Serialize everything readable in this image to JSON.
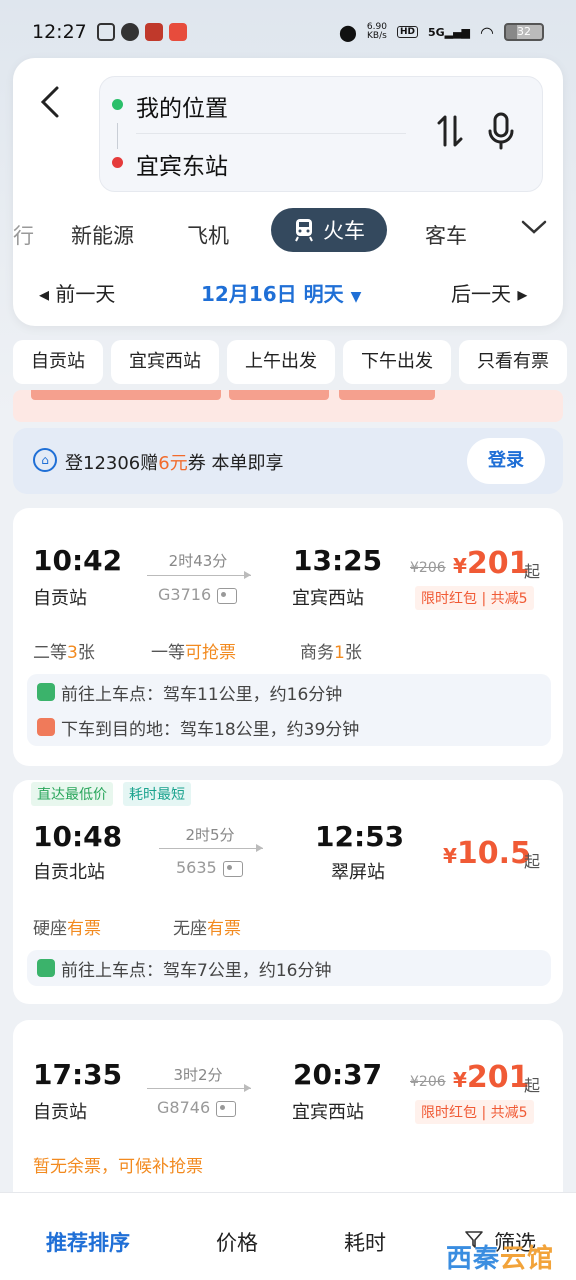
{
  "status_bar": {
    "time": "12:27",
    "speed_value": "6.90",
    "speed_unit": "KB/s",
    "hd": "HD",
    "net": "5G",
    "battery": "32"
  },
  "search": {
    "origin": "我的位置",
    "destination": "宜宾东站",
    "origin_dot_color": "#2bbf6a",
    "destination_dot_color": "#e53b3b"
  },
  "modes": {
    "partial": "行",
    "items": [
      "新能源",
      "飞机",
      "客车"
    ],
    "active": "火车"
  },
  "dates": {
    "prev": "前一天",
    "current": "12月16日 明天",
    "next": "后一天"
  },
  "chips": [
    "自贡站",
    "宜宾西站",
    "上午出发",
    "下午出发",
    "只看有票"
  ],
  "login_banner": {
    "text_a": "登12306赠",
    "amount": "6元",
    "text_b": "券 本单即享",
    "button": "登录"
  },
  "trains": [
    {
      "depart": "10:42",
      "from": "自贡站",
      "duration": "2时43分",
      "train_no": "G3716",
      "arrive": "13:25",
      "to": "宜宾西站",
      "old_price": "¥206",
      "currency": "¥",
      "price": "201",
      "qi": "起",
      "promo": "限时红包 | 共减5",
      "seats": [
        {
          "label": "二等",
          "value": "3",
          "unit": "张"
        },
        {
          "label": "一等",
          "value": "可抢票",
          "unit": ""
        },
        {
          "label": "商务",
          "value": "1",
          "unit": "张"
        }
      ],
      "transfers": [
        "前往上车点：驾车11公里，约16分钟",
        "下车到目的地：驾车18公里，约39分钟"
      ]
    },
    {
      "tags": [
        "直达最低价",
        "耗时最短"
      ],
      "depart": "10:48",
      "from": "自贡北站",
      "duration": "2时5分",
      "train_no": "5635",
      "arrive": "12:53",
      "to": "翠屏站",
      "currency": "¥",
      "price": "10.5",
      "qi": "起",
      "seats": [
        {
          "label": "硬座",
          "value": "有票",
          "unit": ""
        },
        {
          "label": "无座",
          "value": "有票",
          "unit": ""
        }
      ],
      "transfers": [
        "前往上车点：驾车7公里，约16分钟"
      ]
    },
    {
      "depart": "17:35",
      "from": "自贡站",
      "duration": "3时2分",
      "train_no": "G8746",
      "arrive": "20:37",
      "to": "宜宾西站",
      "old_price": "¥206",
      "currency": "¥",
      "price": "201",
      "qi": "起",
      "promo": "限时红包 | 共减5",
      "warning": "暂无余票，可候补抢票"
    }
  ],
  "bottom_bar": {
    "sort": "推荐排序",
    "price": "价格",
    "time": "耗时",
    "filter": "筛选"
  },
  "watermark": {
    "a": "西",
    "b": "秦",
    "c": "云",
    "d": "馆"
  },
  "colors": {
    "accent": "#1f6fd6",
    "price": "#f05a35",
    "highlight": "#f28a1f",
    "active_mode": "#34495e"
  }
}
